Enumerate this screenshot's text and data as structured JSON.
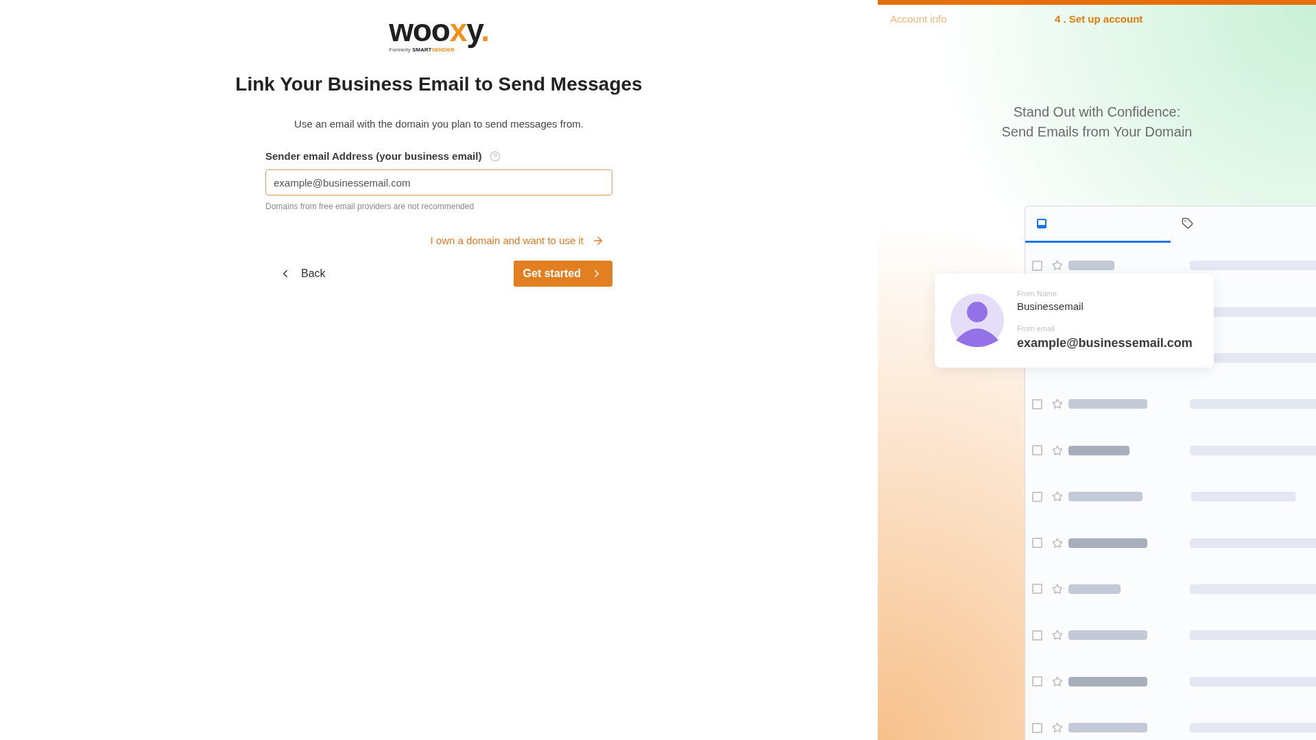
{
  "logo": {
    "wordmark": [
      {
        "text": "woo",
        "accent": false
      },
      {
        "text": "x",
        "accent": true
      },
      {
        "text": "y",
        "accent": false
      },
      {
        "text": ".",
        "accent": true
      }
    ],
    "tagline": "Formerly",
    "brand": [
      {
        "text": "SMART",
        "accent": false
      },
      {
        "text": "SENDER",
        "accent": true
      }
    ]
  },
  "title": "Link Your Business Email to Send Messages",
  "subtitle": "Use an email with the domain you plan to send messages from.",
  "email_field": {
    "label": "Sender email Address (your business email)",
    "placeholder": "example@businessemail.com",
    "hint": "Domains from free email providers are not recommended"
  },
  "domain_link": "I own a domain and want to use it",
  "buttons": {
    "back": "Back",
    "primary": "Get started"
  },
  "steps": [
    {
      "label": "Account info",
      "selected": false
    },
    {
      "label": "4 . Set up account",
      "selected": true
    }
  ],
  "headline": [
    "Stand Out with Confidence:",
    "Send Emails from Your Domain"
  ],
  "mailbox": {
    "tabs": [
      {
        "kind": "inbox",
        "selected": true
      },
      {
        "kind": "tag",
        "selected": false
      }
    ],
    "rows": [
      {
        "checked": false
      },
      {
        "checked": false
      },
      {
        "checked": false
      },
      {
        "checked": false
      },
      {
        "checked": false
      },
      {
        "checked": false
      },
      {
        "checked": false
      },
      {
        "checked": false
      },
      {
        "checked": false
      }
    ]
  },
  "sender_card": {
    "name_label": "From Name",
    "name": "Businessemail",
    "email_label": "From email",
    "email": "example@businessemail.com"
  }
}
